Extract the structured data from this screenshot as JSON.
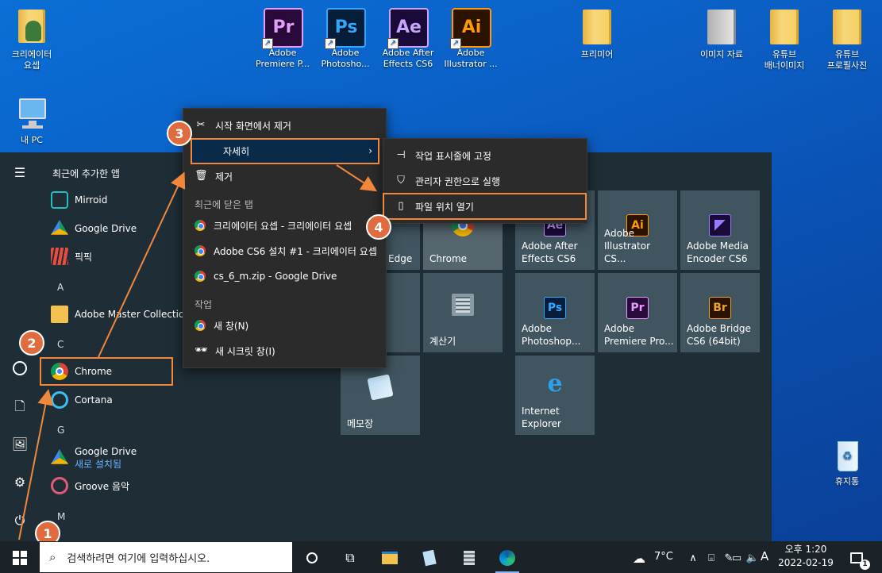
{
  "desktop": {
    "icons": [
      {
        "label1": "크리에이터",
        "label2": "요셉"
      },
      {
        "label": "내 PC"
      },
      {
        "label1": "Adobe",
        "label2": "Premiere P...",
        "abbr": "Pr"
      },
      {
        "label1": "Adobe",
        "label2": "Photosho...",
        "abbr": "Ps"
      },
      {
        "label1": "Adobe After",
        "label2": "Effects CS6",
        "abbr": "Ae"
      },
      {
        "label1": "Adobe",
        "label2": "Illustrator ...",
        "abbr": "Ai"
      },
      {
        "label": "프리미어"
      },
      {
        "label": "이미지 자료"
      },
      {
        "label1": "유튜브",
        "label2": "배너이미지"
      },
      {
        "label1": "유튜브",
        "label2": "프로필사진"
      },
      {
        "label": "휴지통"
      }
    ]
  },
  "start": {
    "recent_header": "최근에 추가한 앱",
    "apps": [
      "Mirroid",
      "Google Drive",
      "픽픽",
      "Adobe Master Collection",
      "Chrome",
      "Cortana",
      "Google Drive",
      "Groove 음악"
    ],
    "google_drive_sub": "새로 설치됨",
    "letters": [
      "A",
      "C",
      "G",
      "M"
    ],
    "tiles": [
      {
        "name": "Edge"
      },
      {
        "name": "Chrome"
      },
      {
        "name1": "Adobe After",
        "name2": "Effects CS6",
        "abbr": "Ae"
      },
      {
        "name1": "Adobe",
        "name2": "Illustrator CS...",
        "abbr": "Ai"
      },
      {
        "name1": "Adobe Media",
        "name2": "Encoder CS6",
        "abbr": ""
      },
      {
        "name": "계산기"
      },
      {
        "name1": "Adobe",
        "name2": "Photoshop...",
        "abbr": "Ps"
      },
      {
        "name1": "Adobe",
        "name2": "Premiere Pro...",
        "abbr": "Pr"
      },
      {
        "name1": "Adobe Bridge",
        "name2": "CS6 (64bit)",
        "abbr": "Br"
      },
      {
        "name": "메모장"
      },
      {
        "name1": "Internet",
        "name2": "Explorer"
      }
    ]
  },
  "context_menu": {
    "unpin": "시작 화면에서 제거",
    "more": "자세히",
    "uninstall": "제거",
    "recent_section": "최근에 닫은 탭",
    "recent_tabs": [
      "크리에이터 요셉 - 크리에이터 요셉",
      "Adobe CS6 설치 #1 - 크리에이터 요셉",
      "cs_6_m.zip - Google Drive"
    ],
    "tasks_section": "작업",
    "new_window": "새 창(N)",
    "new_incognito": "새 시크릿 창(I)"
  },
  "submenu": {
    "pin_taskbar": "작업 표시줄에 고정",
    "run_admin": "관리자 권한으로 실행",
    "open_location": "파일 위치 열기"
  },
  "steps": [
    "1",
    "2",
    "3",
    "4"
  ],
  "taskbar": {
    "search_placeholder": "검색하려면 여기에 입력하십시오.",
    "weather": "7°C",
    "ime": "A",
    "time": "오후 1:20",
    "date": "2022-02-19",
    "notification_count": "1"
  },
  "colors": {
    "accent_orange": "#f0873a",
    "badge": "#e06b3e",
    "start_bg": "#1f2d36",
    "tile_bg": "#415560"
  }
}
